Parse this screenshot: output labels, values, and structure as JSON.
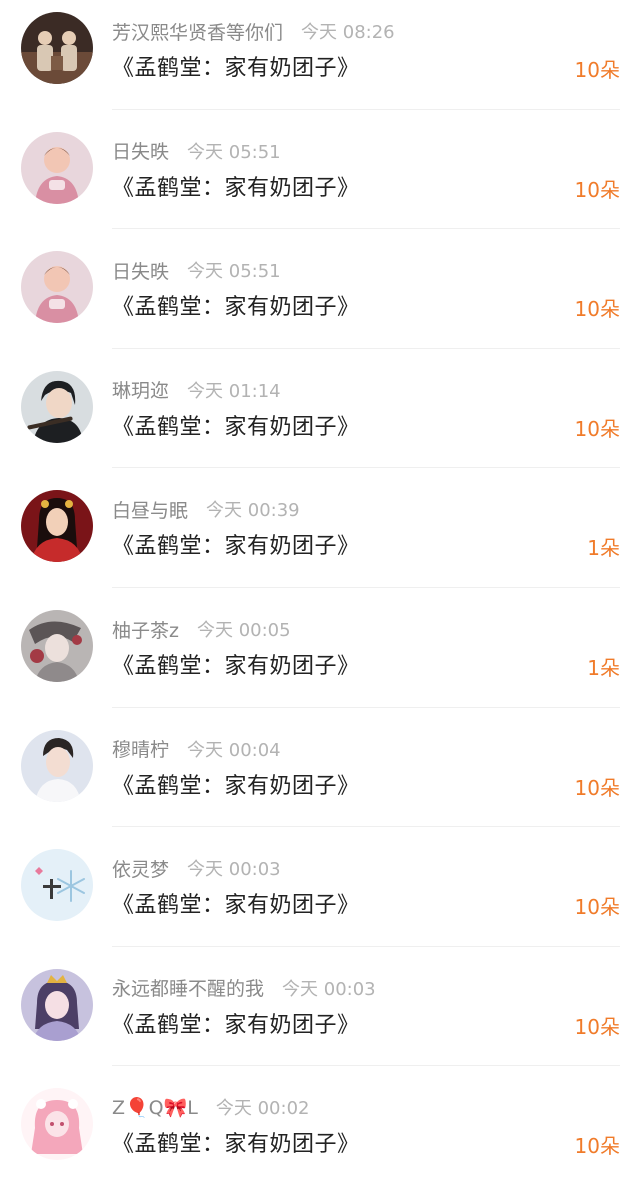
{
  "gifts": [
    {
      "name": "芳汉熙华贤香等你们",
      "time": "今天 08:26",
      "title": "《孟鹤堂：家有奶团子》",
      "count": "10朵",
      "avatar_icon": "avatar-comedy-duo-icon",
      "avatar_colors": [
        "#3b2b25",
        "#d9c8b4",
        "#7d5b45"
      ]
    },
    {
      "name": "日失昳",
      "time": "今天 05:51",
      "title": "《孟鹤堂：家有奶团子》",
      "count": "10朵",
      "avatar_icon": "avatar-child-pink-icon",
      "avatar_colors": [
        "#e8d6dc",
        "#f2c6b4",
        "#d98fa3"
      ]
    },
    {
      "name": "日失昳",
      "time": "今天 05:51",
      "title": "《孟鹤堂：家有奶团子》",
      "count": "10朵",
      "avatar_icon": "avatar-child-pink-icon",
      "avatar_colors": [
        "#e8d6dc",
        "#f2c6b4",
        "#d98fa3"
      ]
    },
    {
      "name": "琳玥迩",
      "time": "今天 01:14",
      "title": "《孟鹤堂：家有奶团子》",
      "count": "10朵",
      "avatar_icon": "avatar-man-flute-icon",
      "avatar_colors": [
        "#d8dde0",
        "#1d1f22",
        "#f0d7c6"
      ]
    },
    {
      "name": "白昼与眠",
      "time": "今天 00:39",
      "title": "《孟鹤堂：家有奶团子》",
      "count": "1朵",
      "avatar_icon": "avatar-woman-red-icon",
      "avatar_colors": [
        "#7a1418",
        "#c62b2b",
        "#f2d0b8"
      ]
    },
    {
      "name": "柚子茶z",
      "time": "今天 00:05",
      "title": "《孟鹤堂：家有奶团子》",
      "count": "1朵",
      "avatar_icon": "avatar-woman-floral-icon",
      "avatar_colors": [
        "#b9b5b4",
        "#a33a45",
        "#ece0dc"
      ]
    },
    {
      "name": "穆晴柠",
      "time": "今天 00:04",
      "title": "《孟鹤堂：家有奶团子》",
      "count": "10朵",
      "avatar_icon": "avatar-man-portrait-icon",
      "avatar_colors": [
        "#dfe4ee",
        "#2a2524",
        "#f3ddd2"
      ]
    },
    {
      "name": "依灵梦",
      "time": "今天 00:03",
      "title": "《孟鹤堂：家有奶团子》",
      "count": "10朵",
      "avatar_icon": "avatar-snowflake-icon",
      "avatar_colors": [
        "#e4f0f8",
        "#9cc6e0",
        "#e87a9c"
      ]
    },
    {
      "name": "永远都睡不醒的我",
      "time": "今天 00:03",
      "title": "《孟鹤堂：家有奶团子》",
      "count": "10朵",
      "avatar_icon": "avatar-girl-crown-icon",
      "avatar_colors": [
        "#c7c2de",
        "#4c3f66",
        "#f5dfe4"
      ]
    },
    {
      "name": "Z🎈Q🎀L",
      "time": "今天 00:02",
      "title": "《孟鹤堂：家有奶团子》",
      "count": "10朵",
      "avatar_icon": "avatar-pink-girl-icon",
      "avatar_colors": [
        "#fff4f6",
        "#f4a7bb",
        "#fbe3e8"
      ]
    }
  ],
  "colors": {
    "count": "#f07b2a",
    "name": "#8a8a8a",
    "time": "#b3b3b3",
    "title": "#222222",
    "divider": "#efefef"
  }
}
